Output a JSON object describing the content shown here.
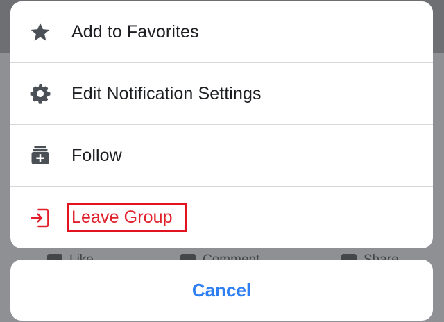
{
  "background": {
    "actions": [
      "Like",
      "Comment",
      "Share"
    ]
  },
  "sheet": {
    "items": [
      {
        "label": "Add to Favorites",
        "icon": "star-icon"
      },
      {
        "label": "Edit Notification Settings",
        "icon": "gear-icon"
      },
      {
        "label": "Follow",
        "icon": "follow-icon"
      },
      {
        "label": "Leave Group",
        "icon": "leave-icon",
        "highlighted": true
      }
    ],
    "cancel_label": "Cancel"
  },
  "colors": {
    "danger": "#e0202a",
    "accent": "#2d7ef2",
    "icon": "#4b4f56"
  }
}
